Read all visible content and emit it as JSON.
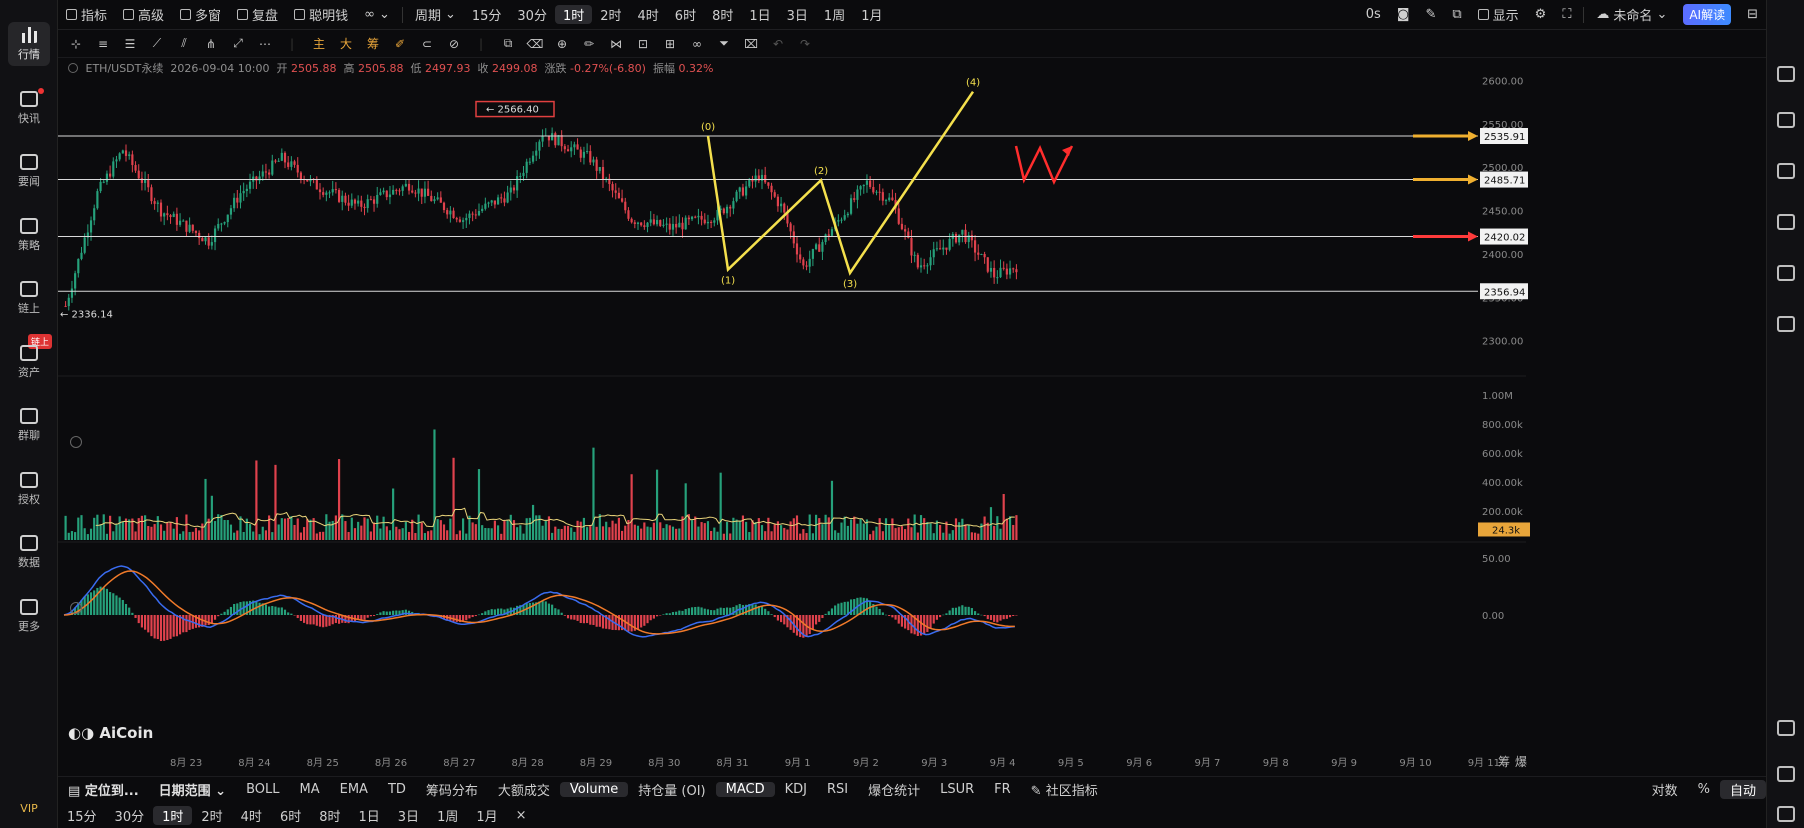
{
  "nav": {
    "items": [
      {
        "label": "行情"
      },
      {
        "label": "快讯"
      },
      {
        "label": "要闻"
      },
      {
        "label": "策略"
      },
      {
        "label": "链上"
      },
      {
        "label": "资产"
      },
      {
        "label": "群聊"
      },
      {
        "label": "授权"
      },
      {
        "label": "数据"
      },
      {
        "label": "更多"
      }
    ],
    "asset_badge": "链上",
    "vip": "VIP"
  },
  "toolbar": {
    "indicators": "指标",
    "advanced": "高级",
    "multi_window": "多窗",
    "replay": "复盘",
    "smart_money": "聪明钱",
    "period": "周期",
    "intervals": [
      "15分",
      "30分",
      "1时",
      "2时",
      "4时",
      "6时",
      "8时",
      "1日",
      "3日",
      "1周",
      "1月"
    ],
    "active_interval": "1时",
    "countdown": "0s",
    "display": "显示",
    "layout_name": "未命名",
    "ai_button": "AI解读"
  },
  "symbol_info": {
    "pair": "ETH/USDT永续",
    "datetime": "2026-09-04 10:00",
    "open_label": "开",
    "open": "2505.88",
    "high_label": "高",
    "high": "2505.88",
    "low_label": "低",
    "low": "2497.93",
    "close_label": "收",
    "close": "2499.08",
    "change_label": "涨跌",
    "change": "-0.27%(-6.80)",
    "amplitude_label": "振幅",
    "amplitude": "0.32%"
  },
  "chart_data": {
    "type": "candlestick",
    "price_axis": {
      "ticks": [
        "2600.00",
        "2550.00",
        "2500.00",
        "2450.00",
        "2400.00",
        "2350.00",
        "2300.00"
      ],
      "range": [
        2280,
        2612
      ]
    },
    "x_axis": {
      "ticks": [
        "8月 23",
        "8月 24",
        "8月 25",
        "8月 26",
        "8月 27",
        "8月 28",
        "8月 29",
        "8月 30",
        "8月 31",
        "9月 1",
        "9月 2",
        "9月 3",
        "9月 4",
        "9月 5",
        "9月 6",
        "9月 7",
        "9月 8",
        "9月 9",
        "9月 10",
        "9月 11"
      ]
    },
    "horizontal_levels": [
      "2535.91",
      "2485.71",
      "2420.02",
      "2356.94"
    ],
    "level_arrow_colors": [
      "#f0b030",
      "#f0b030",
      "#ff3b3b",
      "#ffffff"
    ],
    "high_marker": "2566.40",
    "low_marker": "2336.14",
    "wave_labels": [
      "(0)",
      "(1)",
      "(2)",
      "(3)",
      "(4)"
    ],
    "wave_points": [
      {
        "label": "(0)",
        "price": 2536
      },
      {
        "label": "(1)",
        "price": 2382
      },
      {
        "label": "(2)",
        "price": 2485
      },
      {
        "label": "(3)",
        "price": 2378
      },
      {
        "label": "(4)",
        "price": 2587
      }
    ],
    "wave_color": "#f4e04d",
    "volume_axis": {
      "ticks": [
        "1.00M",
        "800.00k",
        "600.00k",
        "400.00k",
        "200.00k"
      ],
      "current": "24.3k"
    },
    "macd_axis": {
      "ticks": [
        "50.00",
        "0.00"
      ]
    },
    "up_color": "#26a17b",
    "down_color": "#e0424d"
  },
  "indicator_bar": {
    "locate": "定位到...",
    "date_range": "日期范围",
    "items": [
      "BOLL",
      "MA",
      "EMA",
      "TD",
      "筹码分布",
      "大额成交",
      "Volume",
      "持仓量 (OI)",
      "MACD",
      "KDJ",
      "RSI",
      "爆仓统计",
      "LSUR",
      "FR",
      "社区指标"
    ],
    "active": [
      "Volume",
      "MACD"
    ],
    "log": "对数",
    "percent": "%",
    "auto": "自动"
  },
  "bottom_intervals": [
    "15分",
    "30分",
    "1时",
    "2时",
    "4时",
    "6时",
    "8时",
    "1日",
    "3日",
    "1周",
    "1月"
  ],
  "bottom_active": "1时",
  "axis_corner": [
    "筹",
    "爆"
  ],
  "watermark": "AiCoin"
}
